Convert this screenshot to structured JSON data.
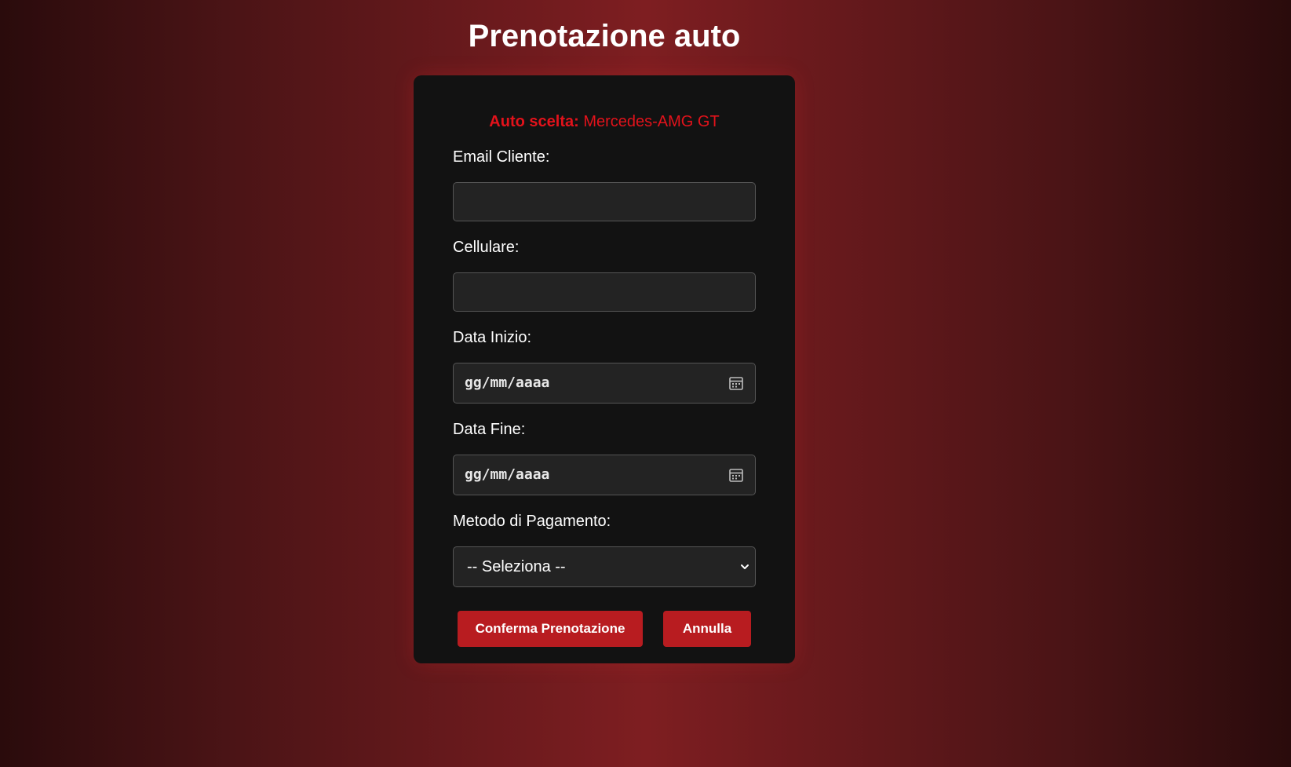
{
  "page": {
    "title": "Prenotazione auto"
  },
  "car": {
    "label": "Auto scelta:",
    "value": "Mercedes-AMG GT"
  },
  "form": {
    "email_label": "Email Cliente:",
    "email_value": "",
    "phone_label": "Cellulare:",
    "phone_value": "",
    "start_date_label": "Data Inizio:",
    "start_date_placeholder": "gg/mm/aaaa",
    "end_date_label": "Data Fine:",
    "end_date_placeholder": "gg/mm/aaaa",
    "payment_label": "Metodo di Pagamento:",
    "payment_selected": "-- Seleziona --"
  },
  "actions": {
    "confirm_label": "Conferma Prenotazione",
    "cancel_label": "Annulla"
  },
  "icons": {
    "date": "calendar-icon",
    "select": "chevron-down-icon"
  },
  "colors": {
    "accent": "#b81c20",
    "car_text": "#e3121b",
    "card_bg": "#121212",
    "input_bg": "#232323"
  }
}
